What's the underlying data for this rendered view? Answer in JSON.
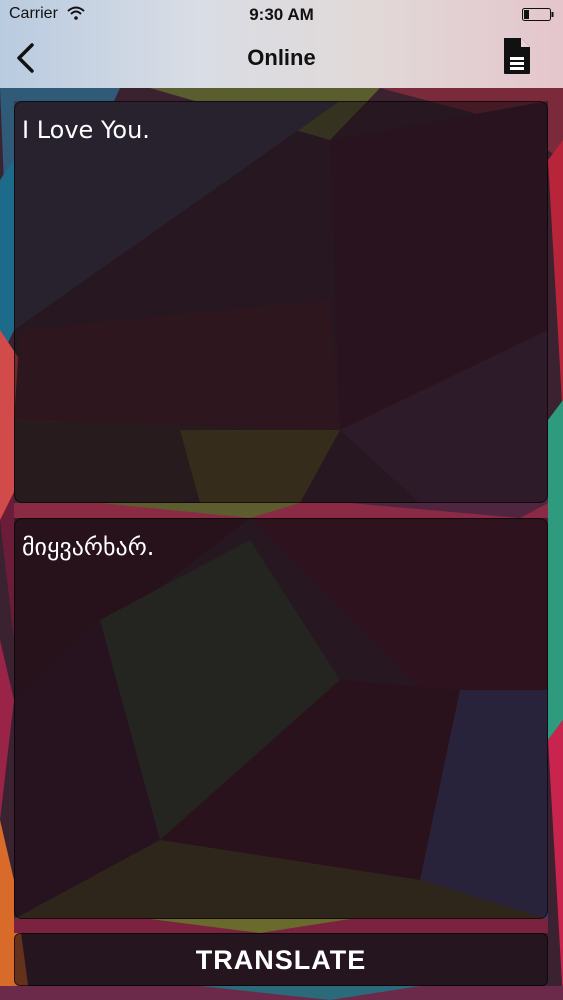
{
  "status_bar": {
    "carrier": "Carrier",
    "time": "9:30 AM",
    "wifi_icon": "wifi-icon",
    "battery_icon": "battery-icon"
  },
  "nav": {
    "title": "Online",
    "back_icon": "chevron-left-icon",
    "document_icon": "document-icon"
  },
  "input": {
    "text": "I Love You."
  },
  "output": {
    "text": "მიყვარხარ."
  },
  "actions": {
    "translate_label": "TRANSLATE"
  },
  "colors": {
    "panel_text": "#ffffff",
    "nav_text": "#111111"
  }
}
